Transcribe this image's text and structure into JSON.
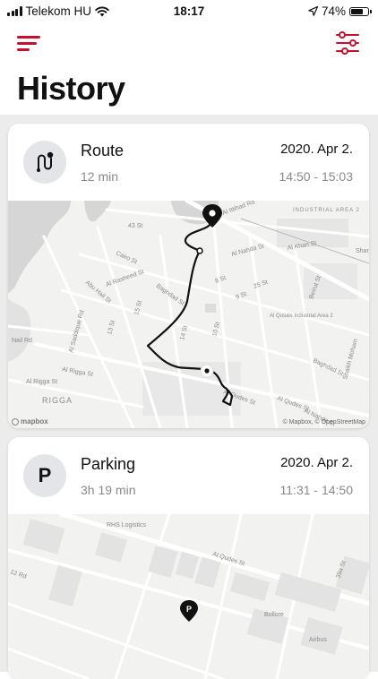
{
  "status_bar": {
    "carrier": "Telekom HU",
    "time": "18:17",
    "battery": "74%",
    "battery_level": 0.74
  },
  "header": {
    "title": "History",
    "menu_icon": "hamburger-menu-icon",
    "filter_icon": "sliders-filter-icon",
    "accent_color": "#c8102e"
  },
  "route_card": {
    "title": "Route",
    "duration": "12 min",
    "date": "2020. Apr 2.",
    "time_range": "14:50 - 15:03",
    "icon": "route-icon",
    "map": {
      "street_labels": [
        "Al Ittihad Rd",
        "Al Nahda St",
        "Al Khan St",
        "Cairo St",
        "Abu Hail St",
        "Al Rasheed St",
        "Baghdad St",
        "Al Qusais Industrial Area 2",
        "INDUSTRIAL AREA 2",
        "Al Qudes St",
        "Al Rigga St",
        "Nail Rd",
        "43 St",
        "14 St",
        "10 St",
        "25 St",
        "Beirut St",
        "Baghdad St",
        "Al Nahda St",
        "15 St",
        "13 St",
        "9 St",
        "8 St",
        "Al Qudes St",
        "Sharj",
        "RIGGA",
        "Al Rigga St",
        "Al Saddique Rd",
        "Shaikh Moham"
      ],
      "logo": "mapbox",
      "attribution": "© Mapbox, © OpenStreetMap"
    }
  },
  "parking_card": {
    "title": "Parking",
    "duration": "3h 19 min",
    "date": "2020. Apr 2.",
    "time_range": "11:31 - 14:50",
    "badge": "P",
    "map": {
      "street_labels": [
        "RHS Logistics",
        "Al Qudes St",
        "39a St",
        "12 Rd",
        "Bollore",
        "Airbus"
      ],
      "pin_label": "P"
    }
  }
}
